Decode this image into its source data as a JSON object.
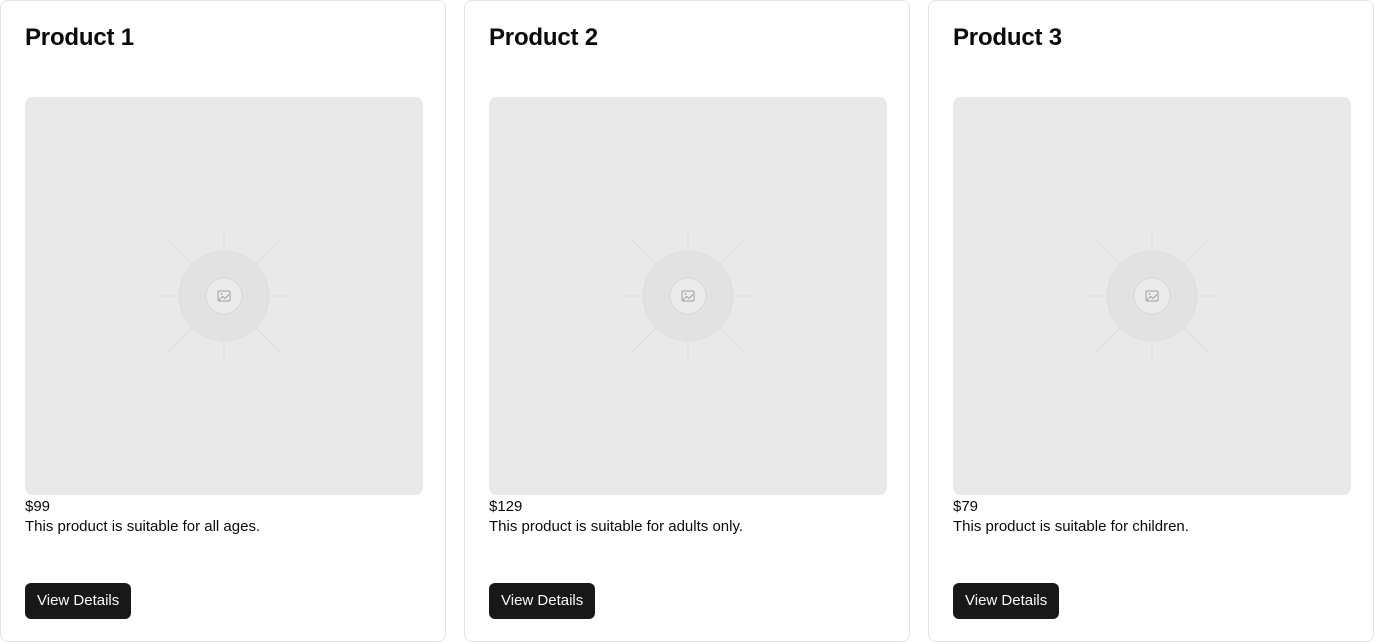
{
  "products": [
    {
      "title": "Product 1",
      "price": "$99",
      "description": "This product is suitable for all ages.",
      "button_label": "View Details"
    },
    {
      "title": "Product 2",
      "price": "$129",
      "description": "This product is suitable for adults only.",
      "button_label": "View Details"
    },
    {
      "title": "Product 3",
      "price": "$79",
      "description": "This product is suitable for children.",
      "button_label": "View Details"
    }
  ],
  "colors": {
    "card_border": "#e4e4e7",
    "image_placeholder": "#e9e9e9",
    "button_bg": "#18181b",
    "button_text": "#fafafa"
  },
  "icons": {
    "image_placeholder": "image-icon"
  }
}
